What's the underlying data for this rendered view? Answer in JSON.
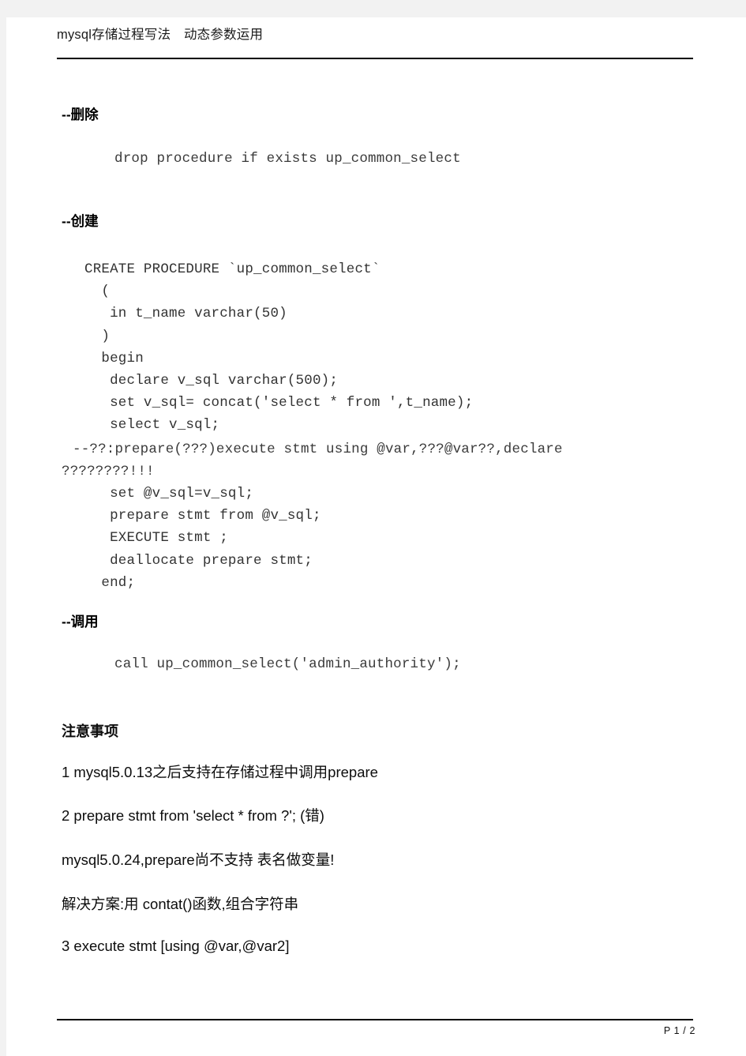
{
  "document": {
    "title": "mysql存储过程写法　动态参数运用",
    "page_label": "P 1 / 2"
  },
  "sections": {
    "delete": {
      "heading": "--删除",
      "code": "drop procedure if exists up_common_select"
    },
    "create": {
      "heading": "--创建",
      "code_lines": [
        "CREATE PROCEDURE `up_common_select`",
        "  (",
        "   in t_name varchar(50)",
        "  )",
        "  begin",
        "   declare v_sql varchar(500);",
        "   set v_sql= concat('select * from ',t_name);",
        "   select v_sql;"
      ],
      "comment_line": "--??:prepare(???)execute stmt using @var,???@var??,declare",
      "comment_wrap": "????????!!!",
      "code_lines_after": [
        "   set @v_sql=v_sql;",
        "   prepare stmt from @v_sql;",
        "   EXECUTE stmt ;",
        "   deallocate prepare stmt;",
        "  end;"
      ]
    },
    "call": {
      "heading": "--调用",
      "code": "call up_common_select('admin_authority');"
    }
  },
  "notes": {
    "heading": "注意事项",
    "items": [
      "1 mysql5.0.13之后支持在存储过程中调用prepare",
      "2 prepare stmt from 'select * from ?'; (错)",
      "mysql5.0.24,prepare尚不支持 表名做变量!",
      "解决方案:用 contat()函数,组合字符串",
      "3 execute stmt [using @var,@var2]"
    ]
  }
}
